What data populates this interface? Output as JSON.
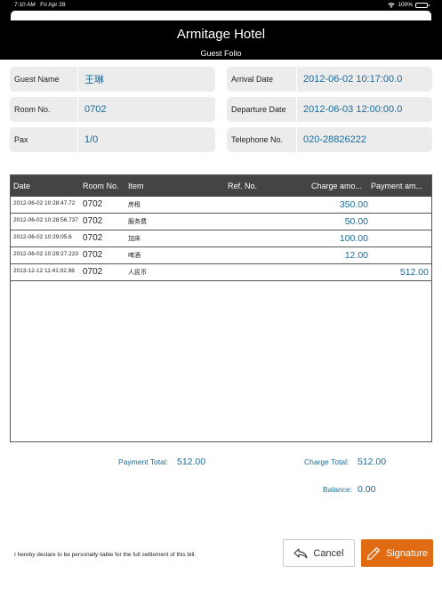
{
  "status_bar": {
    "time": "7:10 AM",
    "date": "Fri Apr 28",
    "battery": "100%"
  },
  "header": {
    "title": "Armitage Hotel",
    "subtitle": "Guest Folio"
  },
  "guest": {
    "name_label": "Guest Name",
    "name_value": "王琳",
    "room_label": "Room No.",
    "room_value": "0702",
    "pax_label": "Pax",
    "pax_value": "1/0",
    "arrival_label": "Arrival Date",
    "arrival_value": "2012-06-02 10:17:00.0",
    "departure_label": "Departure Date",
    "departure_value": "2012-06-03 12:00:00.0",
    "phone_label": "Telephone No.",
    "phone_value": "020-28826222"
  },
  "table": {
    "headers": [
      "Date",
      "Room No.",
      "Item",
      "Ref. No.",
      "Charge amo...",
      "Payment am..."
    ],
    "rows": [
      {
        "date": "2012-06-02 10:28:47.72",
        "room": "0702",
        "item": "房租",
        "ref": "",
        "charge": "350.00",
        "payment": ""
      },
      {
        "date": "2012-06-02 10:28:56.737",
        "room": "0702",
        "item": "服务费",
        "ref": "",
        "charge": "50.00",
        "payment": ""
      },
      {
        "date": "2012-06-02 10:29:05.6",
        "room": "0702",
        "item": "加床",
        "ref": "",
        "charge": "100.00",
        "payment": ""
      },
      {
        "date": "2012-06-02 10:29:27.223",
        "room": "0702",
        "item": "啤酒",
        "ref": "",
        "charge": "12.00",
        "payment": ""
      },
      {
        "date": "2013-12-12 11:41:02.98",
        "room": "0702",
        "item": "人民币",
        "ref": "",
        "charge": "",
        "payment": "512.00"
      }
    ]
  },
  "summary": {
    "payment_total_label": "Payment Total:",
    "payment_total_value": "512.00",
    "charge_total_label": "Charge Total:",
    "charge_total_value": "512.00",
    "balance_label": "Balance:",
    "balance_value": "0.00"
  },
  "footer": {
    "declaration": "I hereby declare to be personally liable for the full settlement of this bill.",
    "cancel_label": "Cancel",
    "signature_label": "Signature"
  },
  "colors": {
    "accent_text": "#1c6a96",
    "signature_button": "#e16b12",
    "table_header": "#444444"
  }
}
